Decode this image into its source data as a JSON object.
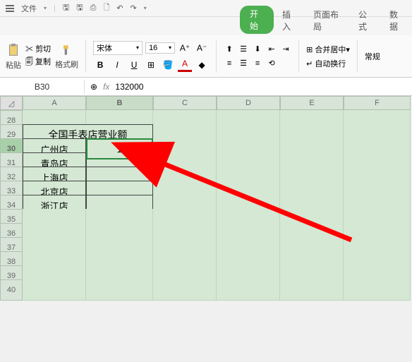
{
  "topbar": {
    "file_label": "文件"
  },
  "tabs": {
    "start": "开始",
    "insert": "插入",
    "page_layout": "页面布局",
    "formula": "公式",
    "data": "数据"
  },
  "ribbon": {
    "paste": "粘贴",
    "cut": "剪切",
    "copy": "复制",
    "format_painter": "格式刷",
    "font_name": "宋体",
    "font_size": "16",
    "merge_center": "合并居中",
    "auto_wrap": "自动换行",
    "general": "常规"
  },
  "namebox": "B30",
  "formula": "132000",
  "cols": [
    "A",
    "B",
    "C",
    "D",
    "E",
    "F"
  ],
  "rows": [
    "28",
    "29",
    "30",
    "31",
    "32",
    "33",
    "34",
    "35",
    "36",
    "37",
    "38",
    "39",
    "40"
  ],
  "table": {
    "title": "全国手表店营业额",
    "r30a": "广州店",
    "r30b": "132000",
    "r31a": "青岛店",
    "r32a": "上海店",
    "r33a": "北京店",
    "r34a": "浙江店"
  }
}
